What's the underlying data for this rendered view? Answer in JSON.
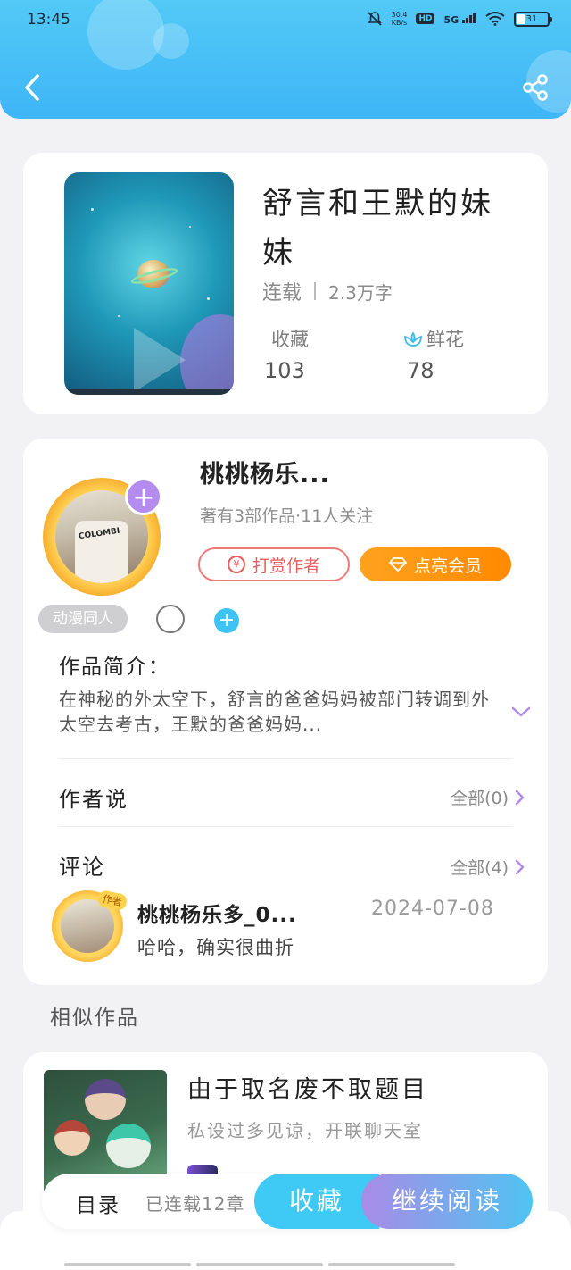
{
  "status_bar": {
    "time": "13:45",
    "net_speed_top": "30.4",
    "net_speed_bottom": "KB/s",
    "hd": "HD",
    "network": "5G",
    "battery": "31"
  },
  "icons": {
    "back": "back-arrow-icon",
    "share": "share-icon",
    "flower": "flower-icon",
    "chevron_down": "chevron-down-icon",
    "chevron_right": "chevron-right-icon",
    "coin": "coin-icon",
    "diamond": "diamond-icon"
  },
  "book": {
    "title": "舒言和王默的妹妹",
    "status": "连载",
    "word_count": "2.3万字",
    "favorites_label": "收藏",
    "favorites_value": "103",
    "flowers_label": "鲜花",
    "flowers_value": "78"
  },
  "author": {
    "name": "桃桃杨乐...",
    "avatar_shirt_text": "COLOMBI",
    "summary": "著有3部作品·11人关注",
    "tip_button": "打赏作者",
    "tip_coin": "¥",
    "vip_button": "点亮会员",
    "tag": "动漫同人",
    "add": "+"
  },
  "intro": {
    "title": "作品简介：",
    "text": "在神秘的外太空下，舒言的爸爸妈妈被部门转调到外太空去考古，王默的爸爸妈妈..."
  },
  "author_says": {
    "title": "作者说",
    "link": "全部(0)"
  },
  "comments": {
    "title": "评论",
    "link": "全部(4)",
    "items": [
      {
        "badge": "作者",
        "name": "桃桃杨乐多_0...",
        "date": "2024-07-08",
        "text": "哈哈，确实很曲折"
      }
    ]
  },
  "similar": {
    "section_title": "相似作品",
    "items": [
      {
        "title": "由于取名废不取题目",
        "subtitle": "私设过多见谅，开联聊天室"
      }
    ]
  },
  "actions": {
    "catalog": "目录",
    "chapters": "已连载12章",
    "favorite": "收藏",
    "read": "继续阅读"
  },
  "colors": {
    "header": "#3eb6f7",
    "accent_blue": "#3ecaf4",
    "accent_purple": "#b48cf0",
    "vip_orange": "#ff8a00",
    "tip_red": "#ea5a5a"
  }
}
